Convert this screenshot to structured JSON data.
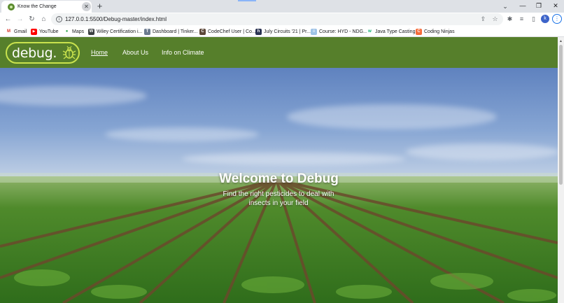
{
  "browser": {
    "tab": {
      "title": "Know the Change",
      "close_glyph": "✕"
    },
    "new_tab_glyph": "+",
    "address": "127.0.0.1:5500/Debug-master/index.html",
    "profile_initial": "k",
    "bookmarks": [
      {
        "label": "Gmail",
        "icon": "gmail-icon",
        "color": "#d93025",
        "glyph": "M"
      },
      {
        "label": "YouTube",
        "icon": "youtube-icon",
        "color": "#ff0000",
        "glyph": "▶"
      },
      {
        "label": "Maps",
        "icon": "maps-icon",
        "color": "#34a853",
        "glyph": "●"
      },
      {
        "label": "Wiley Certification i...",
        "icon": "wiley-icon",
        "color": "#3c4043",
        "glyph": "W"
      },
      {
        "label": "Dashboard | Tinker...",
        "icon": "tinkercad-icon",
        "color": "#6b7a8f",
        "glyph": "T"
      },
      {
        "label": "CodeChef User | Co...",
        "icon": "codechef-icon",
        "color": "#5b4638",
        "glyph": "C"
      },
      {
        "label": "July Circuits '21 | Pr...",
        "icon": "hackerearth-icon",
        "color": "#2c3454",
        "glyph": "h"
      },
      {
        "label": "Course: HYD - NDG...",
        "icon": "course-icon",
        "color": "#9ec3e6",
        "glyph": "≡"
      },
      {
        "label": "Java Type Casting",
        "icon": "w3schools-icon",
        "color": "#04aa6d",
        "glyph": "w"
      },
      {
        "label": "Coding Ninjas",
        "icon": "codingninjas-icon",
        "color": "#f66c3b",
        "glyph": "C"
      }
    ]
  },
  "site": {
    "logo_text": "debug.",
    "nav": [
      {
        "label": "Home",
        "active": true
      },
      {
        "label": "About Us",
        "active": false
      },
      {
        "label": "Info on Climate",
        "active": false
      }
    ],
    "hero": {
      "title": "Welcome to Debug",
      "subtitle": "Find the right pesticides to deal with insects in your field"
    }
  },
  "colors": {
    "nav_green": "#567f2b",
    "logo_accent": "#c9e24d",
    "sky": "#7e9fd0",
    "crop": "#5c9a35"
  }
}
